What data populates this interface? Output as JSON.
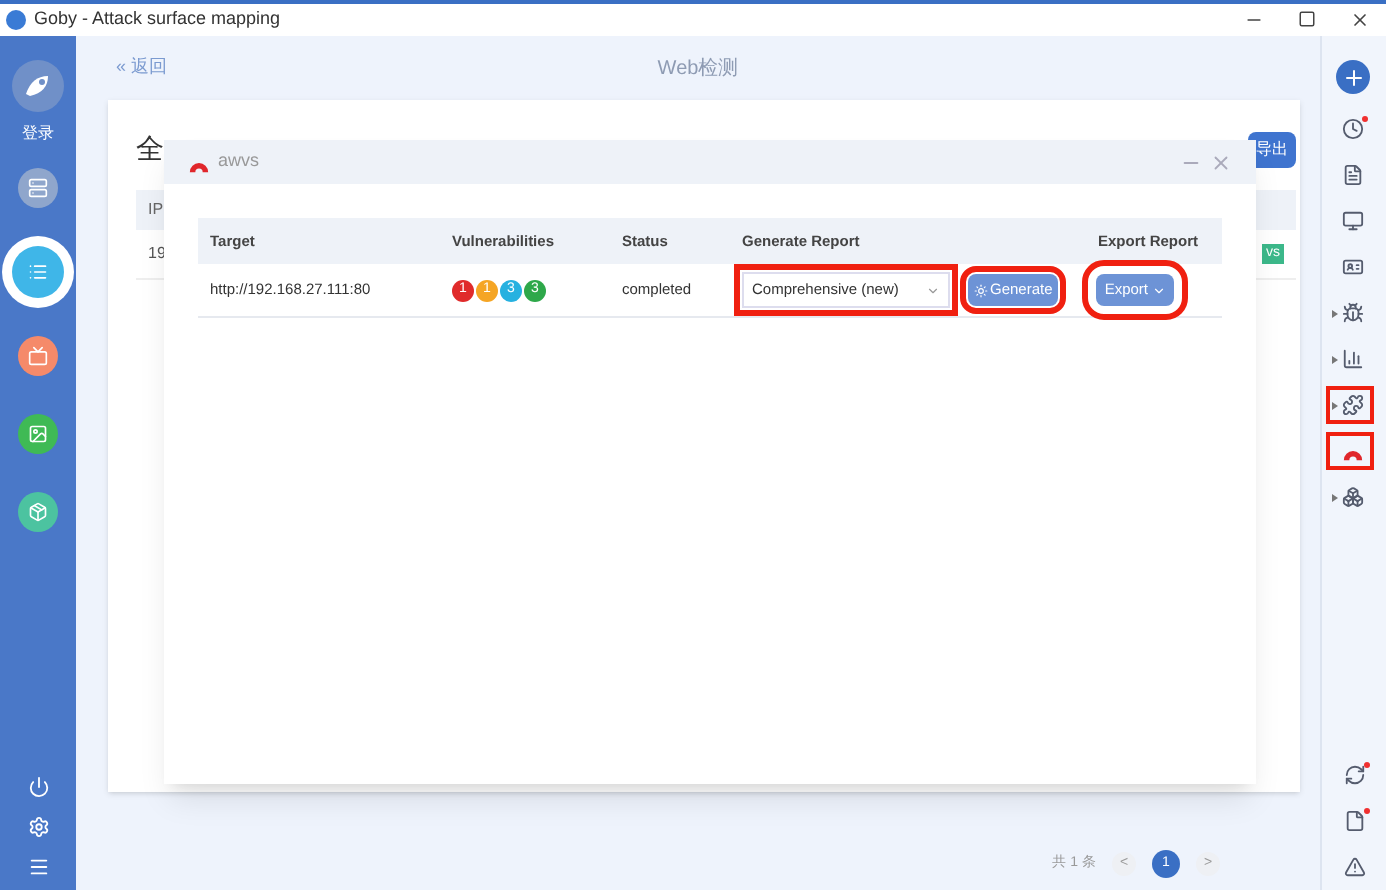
{
  "window": {
    "title": "Goby - Attack surface mapping"
  },
  "left_nav": {
    "login_label": "登录",
    "items": [
      {
        "color": "#8fa6cc",
        "selected": false
      },
      {
        "color": "#3fb6e8",
        "selected": true
      },
      {
        "color": "#f58a6a",
        "selected": false
      },
      {
        "color": "#3fba55",
        "selected": false
      },
      {
        "color": "#4cc3a0",
        "selected": false
      }
    ]
  },
  "page": {
    "back": "« 返回",
    "title": "Web检测",
    "card_title": "全",
    "export_button": "导出",
    "table_header": "IP",
    "table_cell": "19",
    "tag": "vs",
    "pagination": {
      "total": "共 1 条",
      "prev": "<",
      "page": "1",
      "next": ">"
    }
  },
  "dialog": {
    "title": "awvs",
    "columns": [
      "Target",
      "Vulnerabilities",
      "Status",
      "Generate Report",
      "Export Report"
    ],
    "rows": [
      {
        "target": "http://192.168.27.111:80",
        "vulnerabilities": [
          {
            "count": "1",
            "color": "#e02b2b"
          },
          {
            "count": "1",
            "color": "#f5a524"
          },
          {
            "count": "3",
            "color": "#26b1e0"
          },
          {
            "count": "3",
            "color": "#2ea84a"
          }
        ],
        "status": "completed",
        "report_type": "Comprehensive (new)",
        "generate": "Generate",
        "export": "Export"
      }
    ]
  },
  "right_nav": [
    {
      "kind": "plus",
      "caret": false,
      "alert": false,
      "highlighted": false
    },
    {
      "kind": "clock",
      "caret": false,
      "alert": true,
      "highlighted": false
    },
    {
      "kind": "doc",
      "caret": false,
      "alert": false,
      "highlighted": false
    },
    {
      "kind": "monitor",
      "caret": false,
      "alert": false,
      "highlighted": false
    },
    {
      "kind": "card",
      "caret": false,
      "alert": false,
      "highlighted": false
    },
    {
      "kind": "bug",
      "caret": true,
      "alert": false,
      "highlighted": false
    },
    {
      "kind": "chart",
      "caret": true,
      "alert": false,
      "highlighted": false
    },
    {
      "kind": "puzzle",
      "caret": true,
      "alert": false,
      "highlighted": true
    },
    {
      "kind": "awvs",
      "caret": false,
      "alert": false,
      "highlighted": true
    },
    {
      "kind": "puzzle2",
      "caret": true,
      "alert": false,
      "highlighted": false
    }
  ],
  "right_nav_bottom": [
    {
      "kind": "refresh",
      "alert": true
    },
    {
      "kind": "file",
      "alert": true
    },
    {
      "kind": "warning",
      "alert": false
    }
  ]
}
